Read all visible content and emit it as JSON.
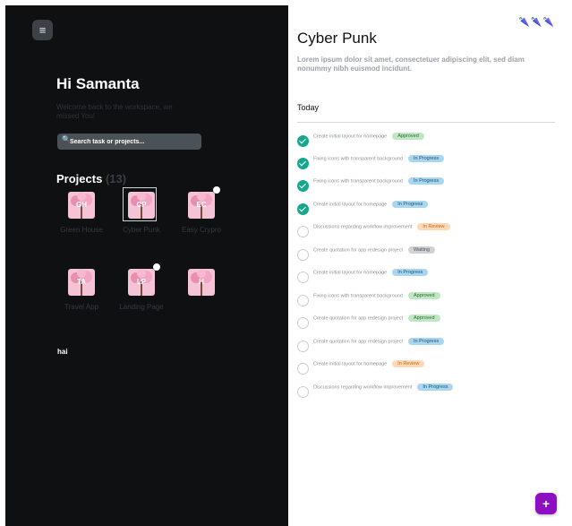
{
  "sidebar": {
    "menu_icon": "≡",
    "greeting": "Hi Samanta",
    "subtitle": "Welcome back to the workspace, we missed You!",
    "search": {
      "icon": "search-icon",
      "placeholder": "Search task or projects..."
    },
    "projects_title": "Projects",
    "projects_count": "(13)",
    "projects": [
      {
        "initials": "GH",
        "name": "Green House",
        "active": false,
        "dot": false
      },
      {
        "initials": "CP",
        "name": "Cyber Punk",
        "active": true,
        "dot": false
      },
      {
        "initials": "EC",
        "name": "Easy Crypro",
        "active": false,
        "dot": true
      },
      {
        "initials": "TA",
        "name": "Travel App",
        "active": false,
        "dot": false
      },
      {
        "initials": "LP",
        "name": "Landing Page",
        "active": false,
        "dot": true
      },
      {
        "initials": "H",
        "name": "",
        "active": false,
        "dot": false
      }
    ],
    "footer": "hai"
  },
  "detail": {
    "icons": "🌂🌂🌂",
    "title": "Cyber Punk",
    "description": "Lorem ipsum dolor sit amet, consectetuer adipiscing elit, sed diam nonummy nibh euismod incidunt.",
    "section": "Today",
    "tasks": [
      {
        "text": "Create initial layout for homepage",
        "status": "Approved",
        "type": "approved",
        "done": true
      },
      {
        "text": "Fixing icons with transparent background",
        "status": "In Progress",
        "type": "progress",
        "done": true
      },
      {
        "text": "Fixing icons with transparent background",
        "status": "In Progress",
        "type": "progress",
        "done": true
      },
      {
        "text": "Create initial layout for homepage",
        "status": "In Progress",
        "type": "progress",
        "done": true
      },
      {
        "text": "Discussions regarding workflow improvement",
        "status": "In Review",
        "type": "review",
        "done": false
      },
      {
        "text": "Create quotation for app redesign project",
        "status": "Waiting",
        "type": "waiting",
        "done": false
      },
      {
        "text": "Create initial layout for homepage",
        "status": "In Progress",
        "type": "progress",
        "done": false
      },
      {
        "text": "Fixing icons with transparent background",
        "status": "Approved",
        "type": "approved",
        "done": false
      },
      {
        "text": "Create quotation for app redesign project",
        "status": "Approved",
        "type": "approved",
        "done": false
      },
      {
        "text": "Create quotation for app redesign project",
        "status": "In Progress",
        "type": "progress",
        "done": false
      },
      {
        "text": "Create initial layout for homepage",
        "status": "In Review",
        "type": "review",
        "done": false
      },
      {
        "text": "Discussions regarding workflow improvement",
        "status": "In Progress",
        "type": "progress",
        "done": false
      }
    ]
  },
  "fab": {
    "label": "+"
  }
}
